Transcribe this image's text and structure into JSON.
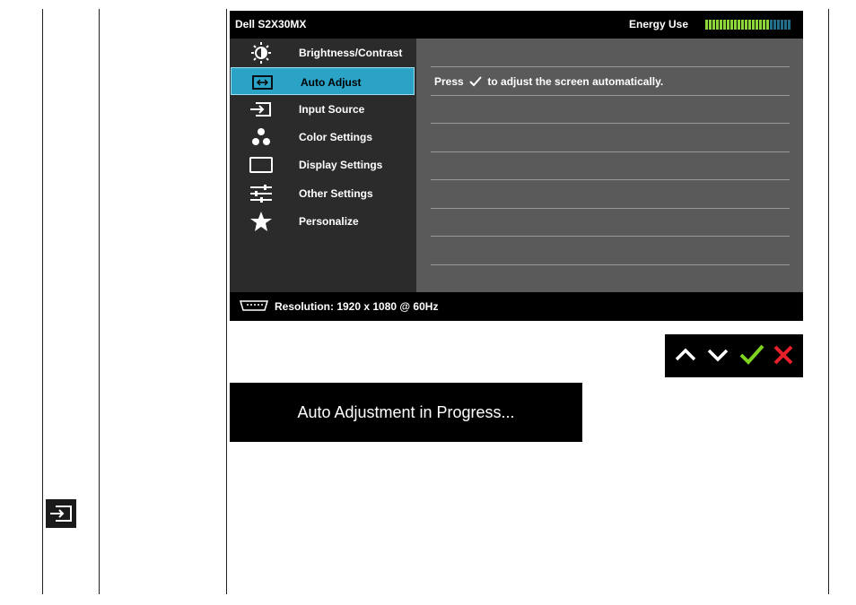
{
  "osd": {
    "model": "Dell S2X30MX",
    "energy_label": "Energy Use",
    "energy_level": 0.75,
    "menu": [
      {
        "label": "Brightness/Contrast",
        "icon": "brightness-icon",
        "selected": false
      },
      {
        "label": "Auto Adjust",
        "icon": "auto-adjust-icon",
        "selected": true
      },
      {
        "label": "Input Source",
        "icon": "input-source-icon",
        "selected": false
      },
      {
        "label": "Color Settings",
        "icon": "color-settings-icon",
        "selected": false
      },
      {
        "label": "Display Settings",
        "icon": "display-settings-icon",
        "selected": false
      },
      {
        "label": "Other Settings",
        "icon": "other-settings-icon",
        "selected": false
      },
      {
        "label": "Personalize",
        "icon": "star-icon",
        "selected": false
      }
    ],
    "message_before": "Press",
    "message_after": "to adjust the screen automatically.",
    "resolution": "Resolution: 1920 x 1080 @ 60Hz",
    "colors": {
      "selected": "#2aa3c6",
      "energy_on": "#8dd63a",
      "energy_off": "#1f6f8a"
    }
  },
  "buttons": {
    "up": "up-arrow-icon",
    "down": "down-arrow-icon",
    "ok": "check-icon",
    "exit": "close-icon",
    "colors": {
      "ok": "#7ed321",
      "exit": "#e8202a"
    }
  },
  "progress_text": "Auto Adjustment in Progress..."
}
